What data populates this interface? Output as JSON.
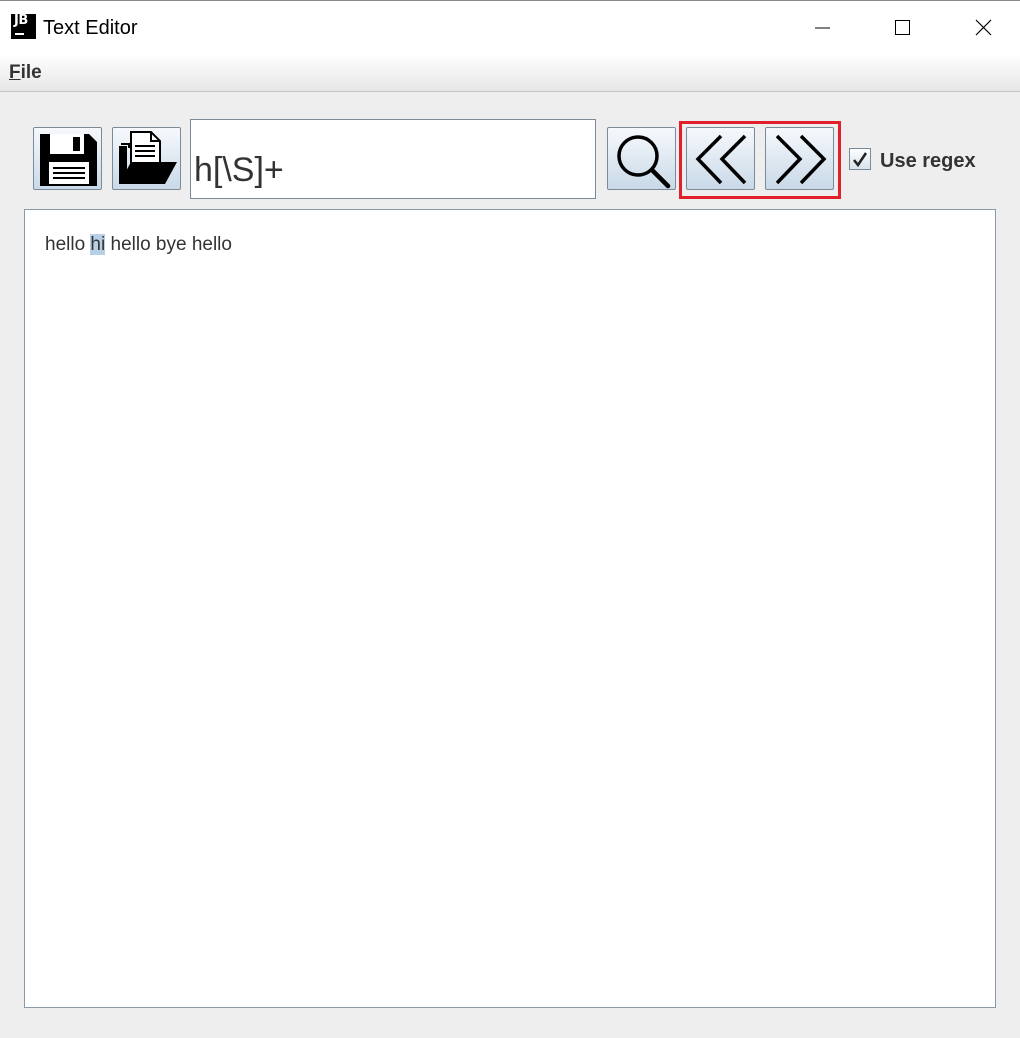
{
  "window": {
    "title": "Text Editor",
    "app_icon_text": "JB"
  },
  "menubar": {
    "file_mnemonic": "F",
    "file_rest": "ile"
  },
  "toolbar": {
    "search_value": "h[\\S]+",
    "use_regex_label": "Use regex",
    "use_regex_checked": true,
    "icons": [
      "save-icon",
      "open-folder-icon",
      "search-icon",
      "previous-icon",
      "next-icon"
    ]
  },
  "editor": {
    "text_before": "hello ",
    "selected_text": "hi",
    "text_after": " hello bye hello"
  },
  "colors": {
    "highlight_border": "#e0202a",
    "selection": "#b8cfe5"
  }
}
